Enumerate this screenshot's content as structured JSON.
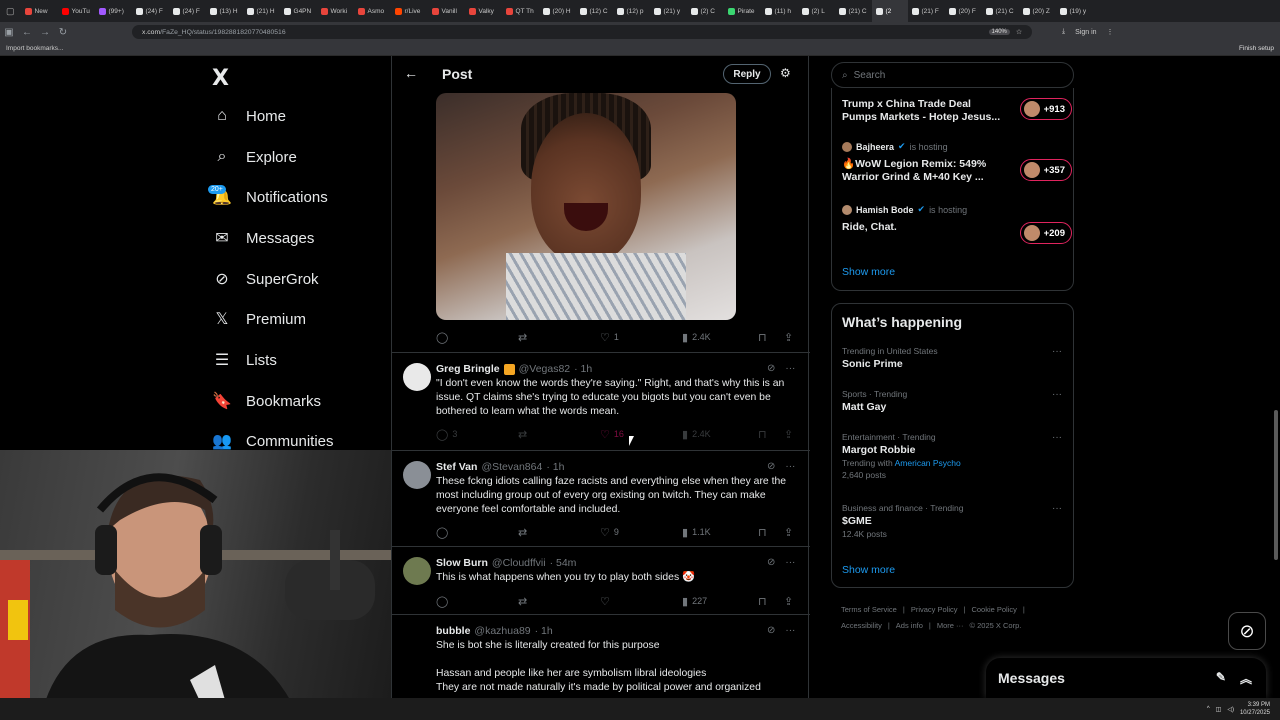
{
  "browser": {
    "tabs": [
      {
        "label": "New",
        "color": "#e8453c"
      },
      {
        "label": "YouTu",
        "color": "#ff0000"
      },
      {
        "label": "(99+)",
        "color": "#a259ff"
      },
      {
        "label": "(24) F",
        "color": "#e7e9ea"
      },
      {
        "label": "(24) F",
        "color": "#e7e9ea"
      },
      {
        "label": "(13) H",
        "color": "#e7e9ea"
      },
      {
        "label": "(21) H",
        "color": "#e7e9ea"
      },
      {
        "label": "G4PN",
        "color": "#e7e9ea"
      },
      {
        "label": "Worki",
        "color": "#e8453c"
      },
      {
        "label": "Asmo",
        "color": "#e8453c"
      },
      {
        "label": "r/Live",
        "color": "#ff4500"
      },
      {
        "label": "Vanill",
        "color": "#e8453c"
      },
      {
        "label": "Valky",
        "color": "#e8453c"
      },
      {
        "label": "QT Th",
        "color": "#e8453c"
      },
      {
        "label": "(20) H",
        "color": "#e7e9ea"
      },
      {
        "label": "(12) C",
        "color": "#e7e9ea"
      },
      {
        "label": "(12) p",
        "color": "#e7e9ea"
      },
      {
        "label": "(21) y",
        "color": "#e7e9ea"
      },
      {
        "label": "(2) C",
        "color": "#e7e9ea"
      },
      {
        "label": "Pirate",
        "color": "#3bd671"
      },
      {
        "label": "(11) h",
        "color": "#e7e9ea"
      },
      {
        "label": "(2) L",
        "color": "#e7e9ea"
      },
      {
        "label": "(21) C",
        "color": "#e7e9ea"
      },
      {
        "label": "(2",
        "color": "#e7e9ea",
        "active": true
      },
      {
        "label": "(21) F",
        "color": "#e7e9ea"
      },
      {
        "label": "(20) F",
        "color": "#e7e9ea"
      },
      {
        "label": "(21) C",
        "color": "#e7e9ea"
      },
      {
        "label": "(20) Z",
        "color": "#e7e9ea"
      },
      {
        "label": "(19) y",
        "color": "#e7e9ea"
      }
    ],
    "url_domain": "x.com",
    "url_path": "/FaZe_HQ/status/1982881820770480516",
    "zoom": "140%",
    "sign_in": "Sign in",
    "import_bookmarks": "Import bookmarks...",
    "finish_setup": "Finish setup"
  },
  "nav": {
    "logo": "X",
    "items": [
      {
        "label": "Home",
        "icon": "home-icon",
        "glyph": "⌂"
      },
      {
        "label": "Explore",
        "icon": "search-icon",
        "glyph": "⌕"
      },
      {
        "label": "Notifications",
        "icon": "bell-icon",
        "glyph": "🔔"
      },
      {
        "label": "Messages",
        "icon": "mail-icon",
        "glyph": "✉"
      },
      {
        "label": "SuperGrok",
        "icon": "grok-icon",
        "glyph": "⊘"
      },
      {
        "label": "Premium",
        "icon": "x-icon",
        "glyph": "𝕏"
      },
      {
        "label": "Lists",
        "icon": "list-icon",
        "glyph": "☰"
      },
      {
        "label": "Bookmarks",
        "icon": "bookmark-icon",
        "glyph": "🔖"
      },
      {
        "label": "Communities",
        "icon": "people-icon",
        "glyph": "👥"
      }
    ],
    "notif_badge": "20+"
  },
  "post": {
    "title": "Post",
    "reply_label": "Reply",
    "media_actions": {
      "reply": "",
      "retweet": "",
      "likes": "1",
      "views": "2.4K"
    },
    "tweets": [
      {
        "name": "Greg Bringle",
        "handle": "@Vegas82",
        "time": "· 1h",
        "body": "\"I don't even know the words they're saying.\" Right, and that's why this is an issue. QT claims she's trying to educate you bigots but you can't even be bothered to learn what the words mean.",
        "replies": "3",
        "retweets": "",
        "likes": "16",
        "views": "2.4K",
        "avatar_color": "#e9e9e9",
        "verified_badge": true
      },
      {
        "name": "Stef Van",
        "handle": "@Stevan864",
        "time": "· 1h",
        "body": "These fckng idiots calling faze racists and everything else when they are the most including group out of every org existing on twitch. They can make everyone feel comfortable and included.",
        "replies": "",
        "retweets": "",
        "likes": "9",
        "views": "1.1K",
        "avatar_color": "#8a8f96",
        "verified_badge": false
      },
      {
        "name": "Slow Burn",
        "handle": "@Cloudffvii",
        "time": "· 54m",
        "body": "This is what happens when you try to play both sides 🤡",
        "replies": "",
        "retweets": "",
        "likes": "",
        "views": "227",
        "avatar_color": "#6e7a50",
        "verified_badge": false
      },
      {
        "name": "bubble",
        "handle": "@kazhua89",
        "time": "· 1h",
        "body_lines": [
          "She is bot she is literally created for this purpose",
          "",
          "Hassan and people like her are  symbolism  libral ideologies",
          "They are not made naturally it's made by political power and organized"
        ],
        "verified_badge": false
      }
    ]
  },
  "right": {
    "search_placeholder": "Search",
    "spaces": [
      {
        "host": "",
        "host_suffix": "",
        "title_lines": [
          "Trump x China Trade Deal",
          "Pumps Markets - Hotep Jesus..."
        ],
        "count": "+913"
      },
      {
        "host": "Bajheera",
        "host_suffix": "is hosting",
        "title_lines": [
          "🔥WoW Legion Remix: 549%",
          "Warrior Grind & M+40 Key ..."
        ],
        "count": "+357"
      },
      {
        "host": "Hamish Bode",
        "host_suffix": "is hosting",
        "title_lines": [
          "Ride, Chat."
        ],
        "count": "+209"
      }
    ],
    "show_more": "Show more",
    "happening_title": "What’s happening",
    "trends": [
      {
        "context": "Trending in United States",
        "title": "Sonic Prime",
        "sub": "",
        "sub_link": ""
      },
      {
        "context": "Sports · Trending",
        "title": "Matt Gay",
        "sub": "",
        "sub_link": ""
      },
      {
        "context": "Entertainment · Trending",
        "title": "Margot Robbie",
        "sub": "Trending with",
        "sub_link": "American Psycho",
        "posts": "2,640 posts"
      },
      {
        "context": "Business and finance · Trending",
        "title": "$GME",
        "sub": "",
        "sub_link": "",
        "posts": "12.4K posts"
      }
    ],
    "footer_line1": [
      "Terms of Service",
      "|",
      "Privacy Policy",
      "|",
      "Cookie Policy",
      "|"
    ],
    "footer_line2": [
      "Accessibility",
      "|",
      "Ads info",
      "|",
      "More ···",
      "© 2025 X Corp."
    ]
  },
  "messages_drawer": {
    "title": "Messages"
  },
  "taskbar": {
    "time": "3:39 PM",
    "date": "10/27/2025"
  }
}
